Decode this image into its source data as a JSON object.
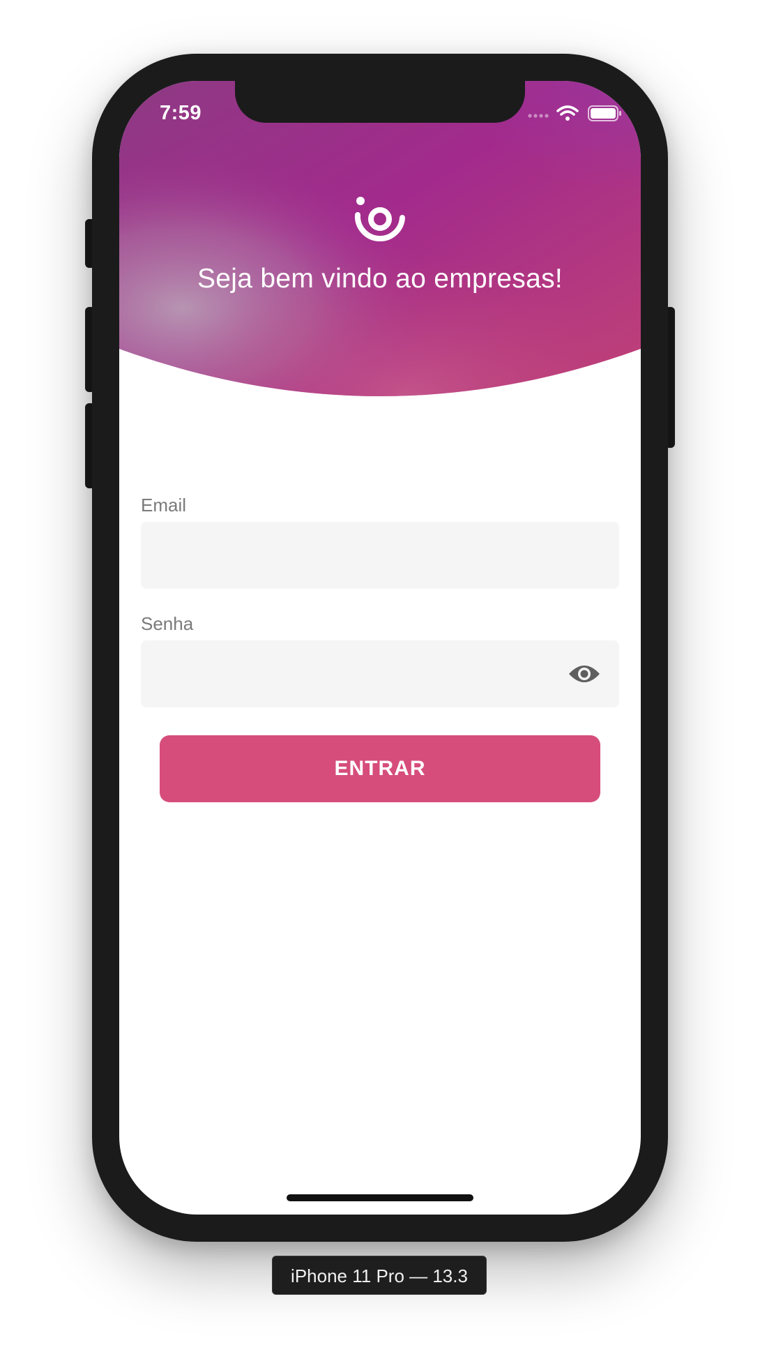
{
  "status_bar": {
    "time": "7:59",
    "signal_icon": "signal-dots-icon",
    "wifi_icon": "wifi-icon",
    "battery_icon": "battery-icon"
  },
  "header": {
    "logo_icon": "ioasys-logo-icon",
    "welcome_text": "Seja bem vindo ao empresas!",
    "gradient_colors": [
      "#8e3a84",
      "#a22a8c",
      "#c04277",
      "#b08aa8"
    ]
  },
  "form": {
    "email": {
      "label": "Email",
      "value": "",
      "placeholder": ""
    },
    "password": {
      "label": "Senha",
      "value": "",
      "placeholder": "",
      "toggle_icon": "eye-icon"
    },
    "submit_label": "ENTRAR"
  },
  "device_caption": "iPhone 11 Pro — 13.3",
  "colors": {
    "accent": "#d64d7c",
    "field_background": "#f5f5f5",
    "label_text": "#7a7a7a",
    "frame": "#1b1b1c"
  }
}
